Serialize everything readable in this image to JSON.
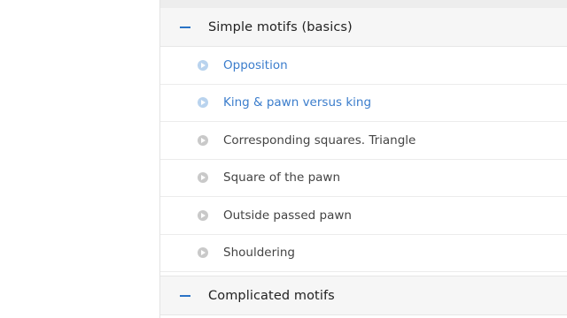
{
  "colors": {
    "accent": "#2a73c6",
    "link_text": "#3b7dcc",
    "muted_text": "#444444",
    "header_bg": "#f6f6f6"
  },
  "sections": [
    {
      "title": "Simple motifs (basics)",
      "toggle_icon": "minus-icon",
      "lessons": [
        {
          "label": "Opposition",
          "icon": "play-circle-icon",
          "state": "accessible"
        },
        {
          "label": "King & pawn versus king",
          "icon": "play-circle-icon",
          "state": "accessible"
        },
        {
          "label": "Corresponding squares. Triangle",
          "icon": "play-circle-icon",
          "state": "locked"
        },
        {
          "label": "Square of the pawn",
          "icon": "play-circle-icon",
          "state": "locked"
        },
        {
          "label": "Outside passed pawn",
          "icon": "play-circle-icon",
          "state": "locked"
        },
        {
          "label": "Shouldering",
          "icon": "play-circle-icon",
          "state": "locked"
        }
      ]
    },
    {
      "title": "Complicated motifs",
      "toggle_icon": "minus-icon",
      "lessons": []
    }
  ]
}
